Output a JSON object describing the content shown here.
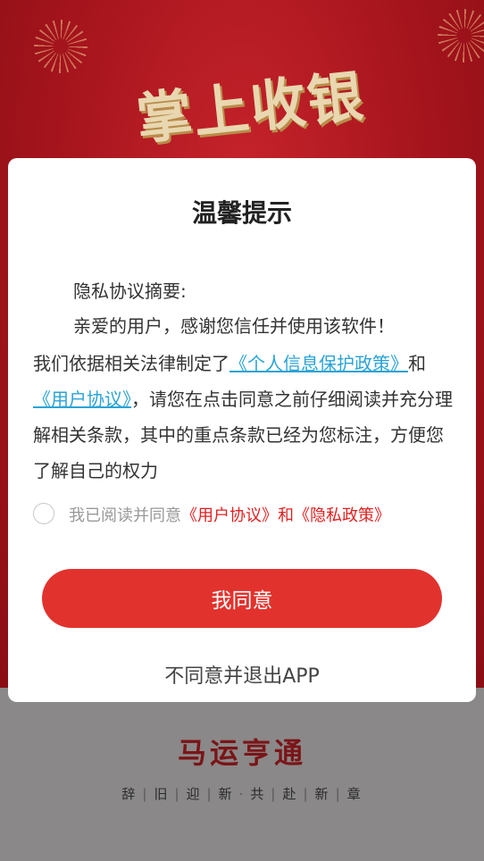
{
  "background": {
    "title": "掌上收银",
    "slogan": "马运亨通",
    "subtitle_chars": [
      "辞",
      "旧",
      "迎",
      "新",
      "共",
      "赴",
      "新",
      "章"
    ]
  },
  "dialog": {
    "title": "温馨提示",
    "summary_title": "隐私协议摘要:",
    "greeting": "亲爱的用户，感谢您信任并使用该软件！",
    "body_prefix": "我们依据相关法律制定了",
    "privacy_link": "《个人信息保护政策》",
    "conj": "和",
    "user_agreement_link": "《用户协议》",
    "body_suffix": "，请您在点击同意之前仔细阅读并充分理解相关条款，其中的重点条款已经为您标注，方便您了解自己的权力",
    "agree_prefix": "我已阅读并同意",
    "agree_links": "《用户协议》和《隐私政策》",
    "agree_button": "我同意",
    "exit_label": "不同意并退出APP"
  },
  "colors": {
    "primary": "#e2322d",
    "link": "#2aa3d6",
    "agree_link": "#e02020"
  }
}
